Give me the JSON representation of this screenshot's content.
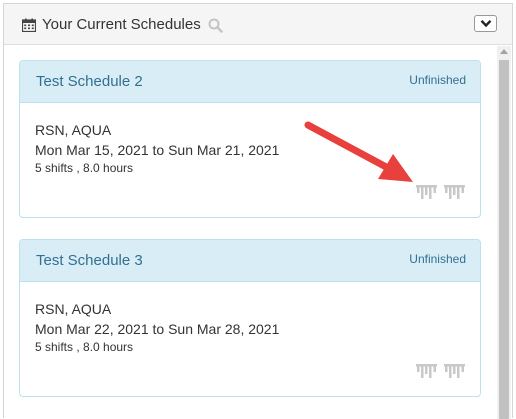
{
  "header": {
    "title": "Your Current Schedules",
    "calendar_icon": "calendar-icon",
    "search_icon": "search-icon",
    "collapse_icon": "chevron-down-icon"
  },
  "schedules": [
    {
      "title": "Test Schedule 2",
      "status": "Unfinished",
      "location": "RSN, AQUA",
      "dates": "Mon Mar 15, 2021 to Sun Mar 21, 2021",
      "summary": "5 shifts , 8.0 hours"
    },
    {
      "title": "Test Schedule 3",
      "status": "Unfinished",
      "location": "RSN, AQUA",
      "dates": "Mon Mar 22, 2021 to Sun Mar 28, 2021",
      "summary": "5 shifts , 8.0 hours"
    }
  ],
  "colors": {
    "card_header_bg": "#d9edf7",
    "card_border": "#bce1ef",
    "card_title": "#31708f",
    "annotation_arrow": "#e8413d",
    "shift_icon": "#c8c8c8"
  }
}
